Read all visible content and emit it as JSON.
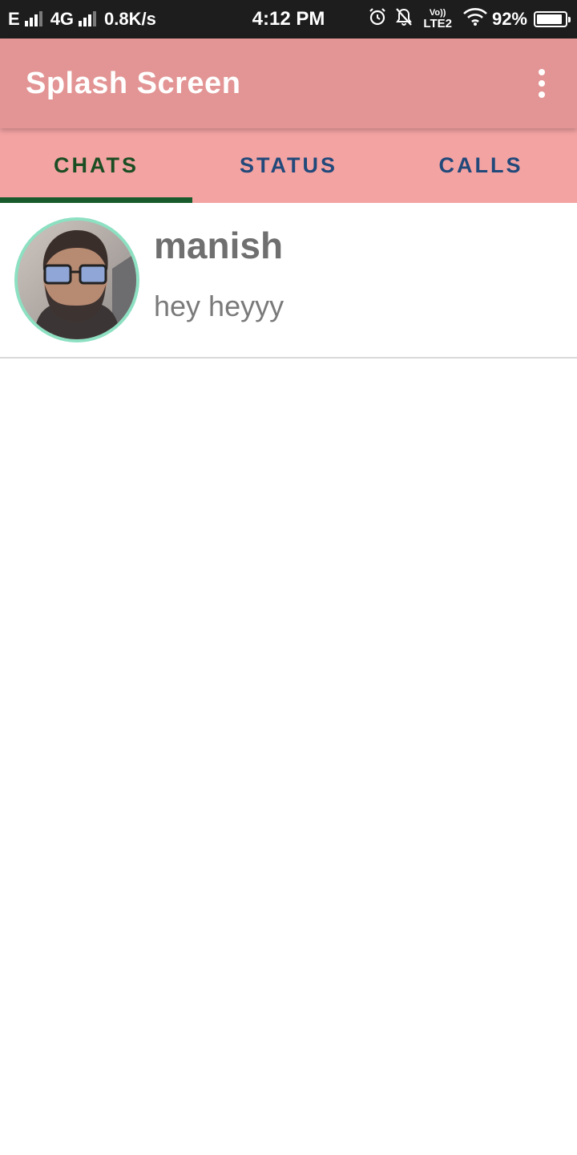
{
  "status_bar": {
    "net1": "E",
    "net2": "4G",
    "speed": "0.8K/s",
    "time": "4:12 PM",
    "volte_top": "Vo))",
    "volte_bottom": "LTE2",
    "battery_pct": "92%",
    "battery_level": 0.92,
    "icons": [
      "signal-icon",
      "alarm-icon",
      "bell-off-icon",
      "wifi-icon",
      "battery-icon"
    ]
  },
  "app_bar": {
    "title": "Splash Screen",
    "menu_icon": "more-vert-icon",
    "color": "#e29594"
  },
  "tabs": [
    {
      "label": "CHATS",
      "active": true
    },
    {
      "label": "STATUS",
      "active": false
    },
    {
      "label": "CALLS",
      "active": false
    }
  ],
  "tab_colors": {
    "background": "#f4a3a3",
    "active_text": "#1b4d23",
    "inactive_text": "#21497a",
    "indicator": "#185a2c"
  },
  "chats": [
    {
      "name": "manish",
      "last_message": "hey heyyy",
      "avatar": "avatar-photo"
    }
  ]
}
